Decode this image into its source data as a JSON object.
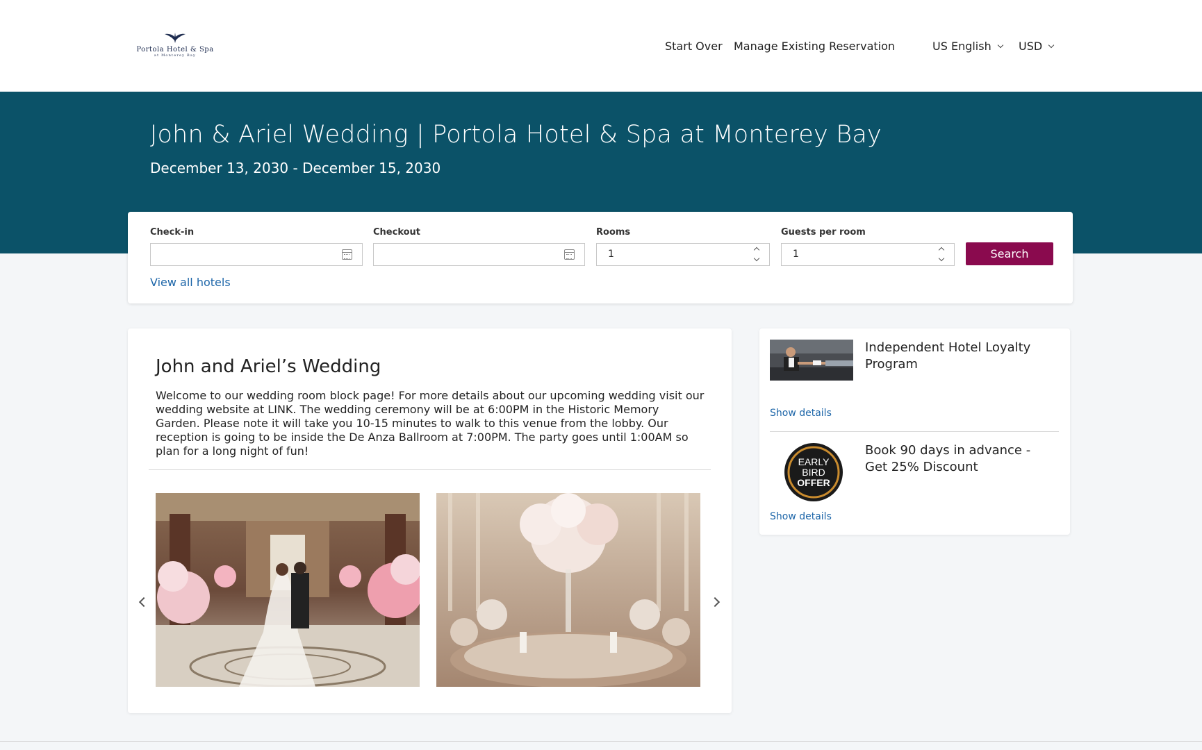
{
  "header": {
    "logo": {
      "brand": "Portola Hotel & Spa",
      "sub": "at Monterey Bay"
    },
    "nav": {
      "start_over": "Start Over",
      "manage": "Manage Existing Reservation",
      "language": "US English",
      "currency": "USD"
    }
  },
  "hero": {
    "title": "John & Ariel Wedding | Portola Hotel & Spa at Monterey Bay",
    "dates": "December 13, 2030 - December 15, 2030"
  },
  "search": {
    "checkin_label": "Check-in",
    "checkin_value": "",
    "checkout_label": "Checkout",
    "checkout_value": "",
    "rooms_label": "Rooms",
    "rooms_value": "1",
    "guests_label": "Guests per room",
    "guests_value": "1",
    "search_button": "Search",
    "view_all": "View all hotels"
  },
  "event": {
    "title": "John and Ariel’s Wedding",
    "description": "Welcome to our wedding room block page! For more details about our upcoming wedding visit our wedding website at LINK. The wedding ceremony will be at 6:00PM in the Historic Memory Garden. Please note it will take you 10-15 minutes to walk to this venue from the lobby. Our reception is going to be inside the De Anza Ballroom at 7:00PM. The party goes until 1:00AM so plan for a long night of fun!"
  },
  "offers": [
    {
      "title": "Independent Hotel Loyalty Program",
      "details": "Show details"
    },
    {
      "title": "Book 90 days in advance - Get 25% Discount",
      "details": "Show details",
      "badge_text": [
        "EARLY",
        "BIRD",
        "OFFER"
      ]
    }
  ],
  "colors": {
    "hero": "#0b5268",
    "accent_button": "#8a0a4e",
    "link": "#1c65a8"
  }
}
